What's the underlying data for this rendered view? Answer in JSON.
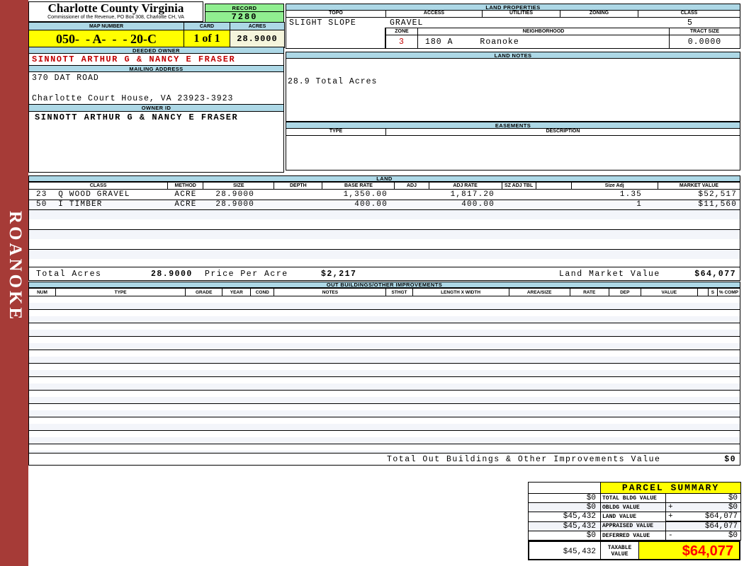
{
  "district": "ROANOKE",
  "county_header": {
    "title": "Charlotte County Virginia",
    "subtitle": "Commissioner of the Revenue, PO Box 308, Charlotte CH, VA"
  },
  "record": {
    "label": "RECORD",
    "value": "7280"
  },
  "map_strip": {
    "map_number_label": "MAP NUMBER",
    "map_number": "050-  - A-  -  - 20-C",
    "card_label": "CARD",
    "card": "1 of 1",
    "acres_label": "ACRES",
    "acres": "28.9000"
  },
  "owner": {
    "deeded_owner_label": "DEEDED OWNER",
    "deeded_owner": "SINNOTT ARTHUR G & NANCY E FRASER",
    "mailing_address_label": "MAILING ADDRESS",
    "address_line1": "370 DAT ROAD",
    "address_line2": "Charlotte Court House, VA 23923-3923",
    "owner_id_label": "OWNER ID",
    "owner_id": "SINNOTT ARTHUR G & NANCY E FRASER"
  },
  "land_properties": {
    "title": "LAND PROPERTIES",
    "topo_label": "TOPO",
    "topo": "SLIGHT SLOPE",
    "access_label": "ACCESS",
    "access": "GRAVEL",
    "utilities_label": "UTILITIES",
    "utilities": "",
    "zoning_label": "ZONING",
    "zoning": "",
    "class_label": "CLASS",
    "class": "5",
    "zone_label": "ZONE",
    "zone": "3",
    "neighborhood_label": "NEIGHBORHOOD",
    "neighborhood_code": "180 A",
    "neighborhood": "Roanoke",
    "tract_size_label": "TRACT SIZE",
    "tract_size": "0.0000"
  },
  "land_notes": {
    "title": "LAND NOTES",
    "note": "28.9 Total Acres"
  },
  "easements": {
    "title": "EASEMENTS",
    "type_label": "TYPE",
    "description_label": "DESCRIPTION"
  },
  "land": {
    "title": "LAND",
    "headers": [
      "CLASS",
      "METHOD",
      "SIZE",
      "DEPTH",
      "BASE RATE",
      "ADJ",
      "ADJ RATE",
      "SZ ADJ TBL",
      "",
      "Size Adj",
      "MARKET VALUE"
    ],
    "rows": [
      {
        "class": "23  Q WOOD GRAVEL",
        "method": "ACRE",
        "size": "28.9000",
        "depth": "",
        "base_rate": "1,350.00",
        "adj": "",
        "adj_rate": "1,817.20",
        "sz_adj_tbl": "",
        "size_adj": "1.35",
        "market_value": "$52,517"
      },
      {
        "class": "50  I TIMBER",
        "method": "ACRE",
        "size": "28.9000",
        "depth": "",
        "base_rate": "400.00",
        "adj": "",
        "adj_rate": "400.00",
        "sz_adj_tbl": "",
        "size_adj": "1",
        "market_value": "$11,560"
      }
    ],
    "total_acres_label": "Total Acres",
    "total_acres": "28.9000",
    "price_per_acre_label": "Price Per Acre",
    "price_per_acre": "$2,217",
    "land_market_value_label": "Land Market Value",
    "land_market_value": "$64,077"
  },
  "out_buildings": {
    "title": "OUT BUILDINGS/OTHER IMPROVEMENTS",
    "headers": [
      "NUM",
      "TYPE",
      "GRADE",
      "YEAR",
      "COND",
      "NOTES",
      "STHGT",
      "LENGTH X WIDTH",
      "AREA/SIZE",
      "RATE",
      "DEP",
      "VALUE",
      "",
      "S",
      "% COMP"
    ],
    "total_label": "Total Out Buildings & Other Improvements Value",
    "total_value": "$0"
  },
  "parcel_summary": {
    "title": "PARCEL SUMMARY",
    "rows": [
      {
        "prior": "$0",
        "label": "TOTAL BLDG VALUE",
        "sign": "",
        "value": "$0"
      },
      {
        "prior": "$0",
        "label": "OBLDG VALUE",
        "sign": "+",
        "value": "$0"
      },
      {
        "prior": "$45,432",
        "label": "LAND VALUE",
        "sign": "+",
        "value": "$64,077"
      },
      {
        "prior": "$45,432",
        "label": "APPRAISED VALUE",
        "sign": "",
        "value": "$64,077"
      },
      {
        "prior": "$0",
        "label": "DEFERRED VALUE",
        "sign": "-",
        "value": "$0"
      }
    ],
    "taxable_prior": "$45,432",
    "taxable_label": "TAXABLE VALUE",
    "taxable_value": "$64,077"
  }
}
